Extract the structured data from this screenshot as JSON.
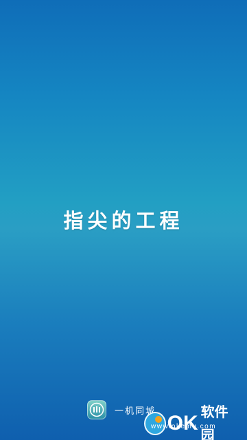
{
  "splash": {
    "slogan": "指尖的工程",
    "background_top": "#0f6db8",
    "background_mid": "#229fc3",
    "background_bottom": "#0f5fae"
  },
  "brand": {
    "logo_icon": "app-logo-icon",
    "name": "一机同城"
  },
  "watermark": {
    "logo_text": "OK",
    "name": "软件园",
    "url": "www.okemu.com"
  }
}
